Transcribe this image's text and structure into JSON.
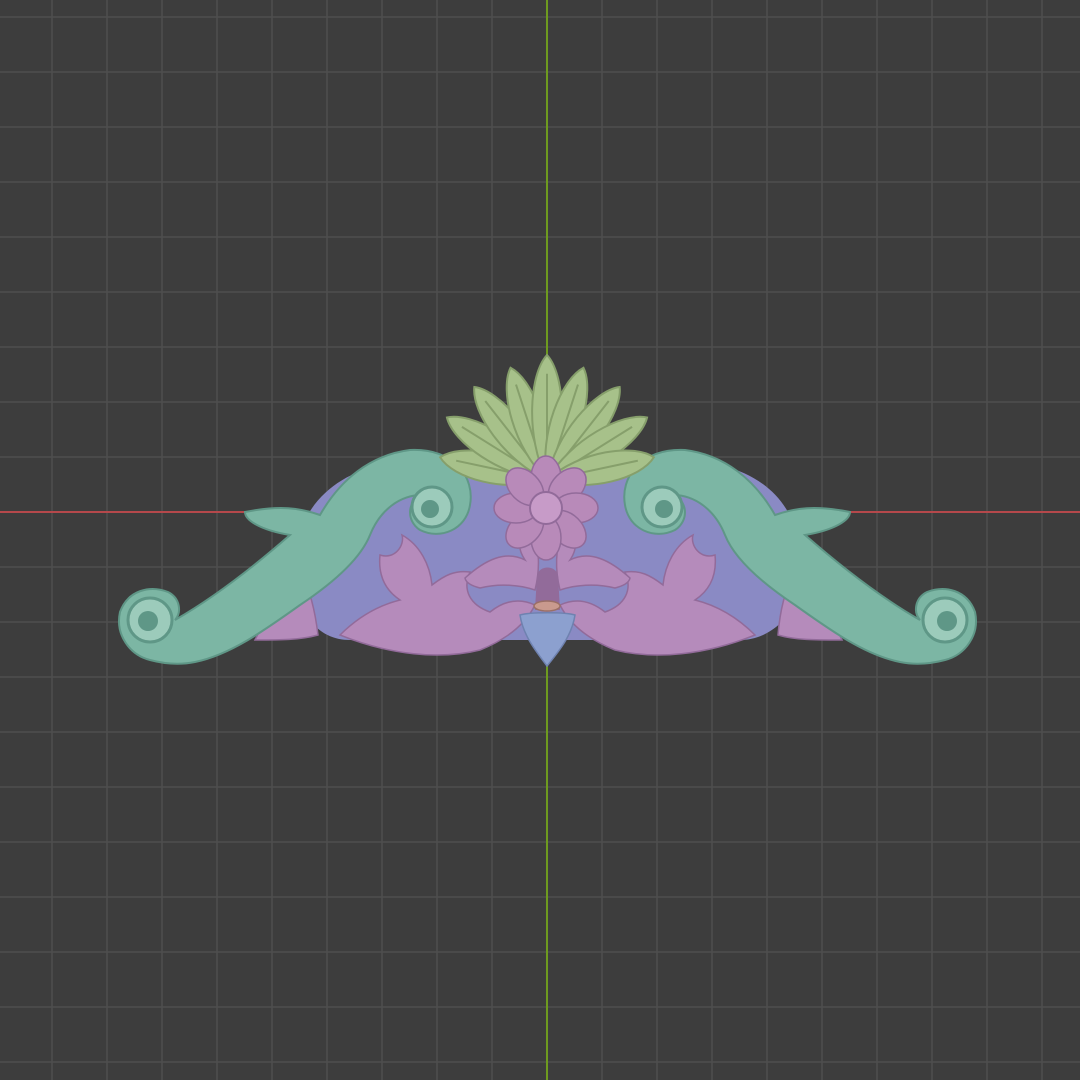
{
  "viewport": {
    "background": "#3d3d3d",
    "grid_color": "#4f4f4f",
    "x_axis_color": "#b5484b",
    "y_axis_color": "#6e9a1f"
  },
  "model": {
    "colors": {
      "scroll": "#7cb6a4",
      "scroll_shade": "#5f9787",
      "scroll_light": "#9ccbbb",
      "palmette": "#a7c18a",
      "palmette_shade": "#869f6b",
      "background_panel": "#8a8ac4",
      "acanthus": "#b58bbb",
      "acanthus_shade": "#926b9a",
      "rosette": "#b88ab9",
      "rosette_center": "#c79bc8",
      "drop": "#8ca0cf",
      "bead": "#c99a8e"
    }
  }
}
